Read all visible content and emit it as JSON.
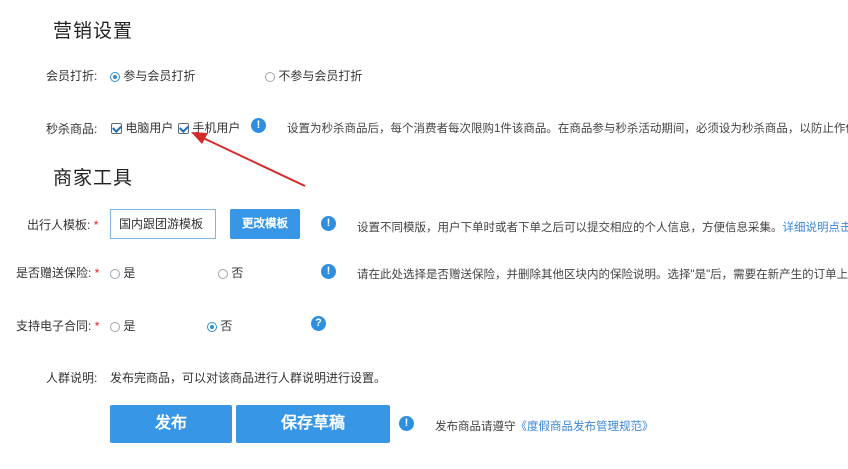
{
  "marketing": {
    "title": "营销设置",
    "member_discount": {
      "label": "会员打折:",
      "option_yes": "参与会员打折",
      "option_no": "不参与会员打折"
    },
    "flash_sale": {
      "label": "秒杀商品:",
      "pc_user": "电脑用户",
      "mobile_user": "手机用户",
      "hint": "设置为秒杀商品后，每个消费者每次限购1件该商品。在商品参与秒杀活动期间，必须设为秒杀商品，以防止作伪"
    }
  },
  "merchant": {
    "title": "商家工具",
    "template": {
      "label": "出行人模板:",
      "required": "*",
      "value": "国内跟团游模板",
      "change_button": "更改模板",
      "hint": "设置不同模版，用户下单时或者下单之后可以提交相应的个人信息，方便信息采集。",
      "hint_link": "详细说明点击"
    },
    "insurance": {
      "label": "是否赠送保险:",
      "required": "*",
      "option_yes": "是",
      "option_no": "否",
      "hint": "请在此处选择是否赠送保险，并删除其他区块内的保险说明。选择\"是\"后，需要在新产生的订单上"
    },
    "e_contract": {
      "label": "支持电子合同:",
      "required": "*",
      "option_yes": "是",
      "option_no": "否"
    },
    "audience": {
      "label": "人群说明:",
      "text": "发布完商品，可以对该商品进行人群说明进行设置。"
    }
  },
  "actions": {
    "publish": "发布",
    "save_draft": "保存草稿",
    "notice_text": "发布商品请遵守",
    "notice_link": "《度假商品发布管理规范》"
  },
  "icons": {
    "info": "info-icon",
    "question": "question-icon",
    "arrow": "red-arrow-annotation"
  },
  "colors": {
    "accent": "#3797e6",
    "required": "#e02020",
    "annotation": "#d42a2a",
    "link": "#3a86d8"
  }
}
